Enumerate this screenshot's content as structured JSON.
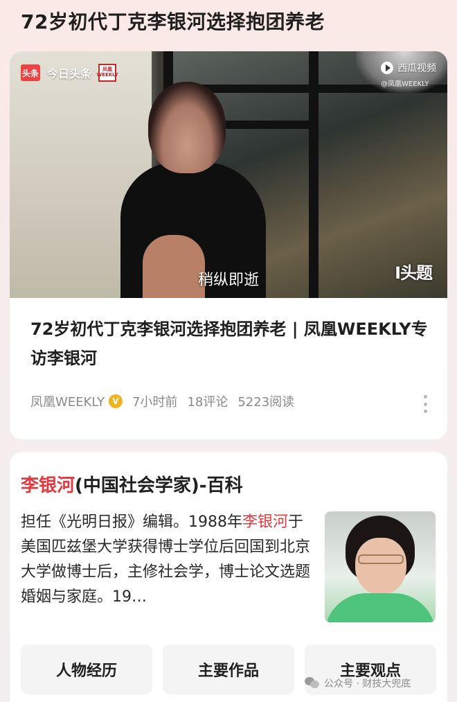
{
  "page_title": "72岁初代丁克李银河选择抱团养老",
  "video_card": {
    "brand_left": {
      "toutiao_badge": "头条",
      "toutiao_name": "今日头条",
      "fenghuang_logo_line1": "凤凰",
      "fenghuang_logo_line2": "WEEKLY"
    },
    "brand_right": {
      "xigua_name": "西瓜视频",
      "handle": "@凤凰WEEKLY"
    },
    "subtitle": "稍纵即逝",
    "watermark": "I头题",
    "title": "72岁初代丁克李银河选择抱团养老 | 凤凰WEEKLY专访李银河",
    "meta": {
      "author": "凤凰WEEKLY",
      "verified_glyph": "V",
      "time": "7小时前",
      "comments": "18评论",
      "reads": "5223阅读"
    }
  },
  "baike_card": {
    "title_name": "李银河",
    "title_rest": "(中国社会学家)-百科",
    "body_part1": "担任《光明日报》编辑。1988年",
    "body_highlight": "李银河",
    "body_part2": "于美国匹兹堡大学获得博士学位后回国到北京大学做博士后，主修社会学，博士论文选题婚姻与家庭。19…",
    "tabs": [
      "人物经历",
      "主要作品",
      "主要观点"
    ]
  },
  "footer_watermark": "公众号 · 财技大兜底",
  "colors": {
    "highlight": "#e0393e",
    "toutiao_red": "#f04142",
    "verified_gold": "#f2b21c"
  }
}
